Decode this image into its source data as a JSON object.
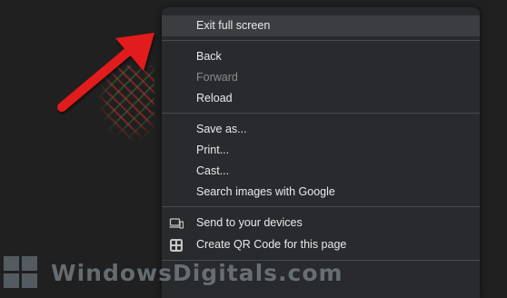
{
  "menu": {
    "items": [
      {
        "label": "Exit full screen",
        "highlighted": true,
        "disabled": false
      },
      {
        "label": "Back",
        "disabled": false
      },
      {
        "label": "Forward",
        "disabled": true
      },
      {
        "label": "Reload",
        "disabled": false
      },
      {
        "label": "Save as...",
        "disabled": false
      },
      {
        "label": "Print...",
        "disabled": false
      },
      {
        "label": "Cast...",
        "disabled": false
      },
      {
        "label": "Search images with Google",
        "disabled": false
      },
      {
        "label": "Send to your devices",
        "icon": "devices-icon",
        "disabled": false
      },
      {
        "label": "Create QR Code for this page",
        "icon": "qr-code-icon",
        "disabled": false
      }
    ]
  },
  "watermark": {
    "text": "WindowsDigitals.com"
  },
  "annotation": {
    "arrow_color": "#e21b1b"
  }
}
